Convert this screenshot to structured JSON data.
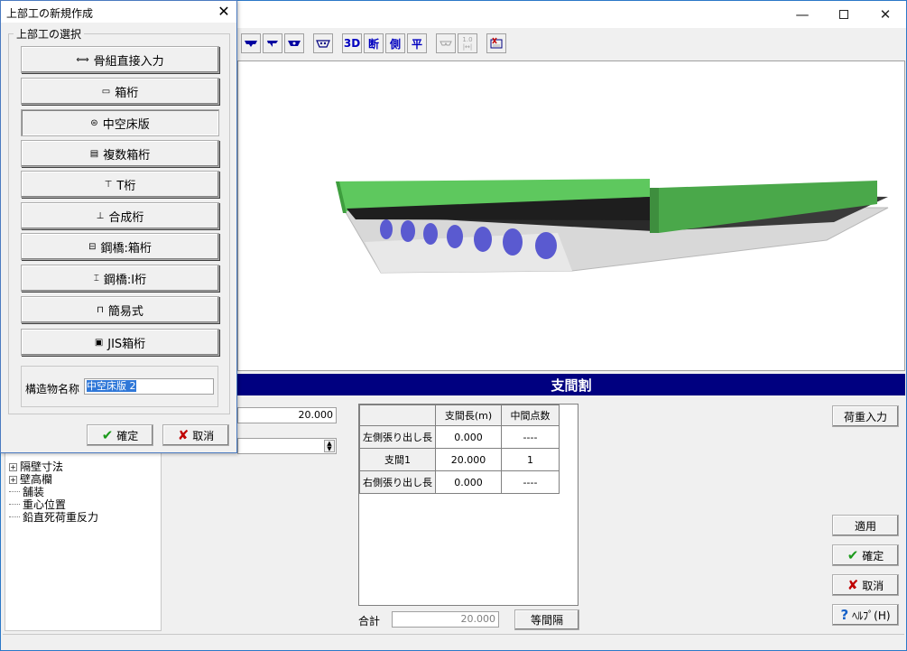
{
  "main_window": {
    "controls": {
      "minimize": "—",
      "close": "✕"
    }
  },
  "toolbar": {
    "buttons": [
      {
        "label": "",
        "icon": "view-front-icon"
      },
      {
        "label": "",
        "icon": "view-curve-icon"
      },
      {
        "label": "",
        "icon": "view-section-icon"
      },
      {
        "label": "",
        "icon": "box-view-icon"
      },
      {
        "label": "3D",
        "icon": "3d-view-icon"
      },
      {
        "label": "断",
        "icon": "section-view-icon"
      },
      {
        "label": "側",
        "icon": "side-view-icon"
      },
      {
        "label": "平",
        "icon": "plan-view-icon"
      },
      {
        "label": "",
        "icon": "bend-icon"
      },
      {
        "label": "1.0",
        "icon": "dimension-icon"
      },
      {
        "label": "",
        "icon": "export-icon"
      }
    ]
  },
  "span_section": {
    "header": "支間割",
    "top_value": "20.000",
    "grid": {
      "columns": [
        "支間長(m)",
        "中間点数"
      ],
      "rows": [
        {
          "label": "左側張り出し長",
          "length": "0.000",
          "points": "----"
        },
        {
          "label": "支間1",
          "length": "20.000",
          "points": "1"
        },
        {
          "label": "右側張り出し長",
          "length": "0.000",
          "points": "----"
        }
      ]
    },
    "total_label": "合計",
    "total_value": "20.000",
    "equal_button": "等間隔"
  },
  "tree": {
    "items": [
      {
        "label": "隔壁寸法",
        "expandable": true
      },
      {
        "label": "壁高欄",
        "expandable": true
      },
      {
        "label": "舗装",
        "expandable": false
      },
      {
        "label": "重心位置",
        "expandable": false
      },
      {
        "label": "鉛直死荷重反力",
        "expandable": false
      }
    ]
  },
  "right_buttons": {
    "load_input": "荷重入力",
    "apply": "適用",
    "ok": "確定",
    "cancel": "取消",
    "help": "ﾍﾙﾌﾟ(H)"
  },
  "dialog": {
    "title": "上部工の新規作成",
    "group_label": "上部工の選択",
    "options": [
      {
        "label": "骨組直接入力",
        "icon": "frame-icon"
      },
      {
        "label": "箱桁",
        "icon": "box-girder-icon"
      },
      {
        "label": "中空床版",
        "icon": "hollow-slab-icon",
        "selected": true
      },
      {
        "label": "複数箱桁",
        "icon": "multi-box-icon"
      },
      {
        "label": "T桁",
        "icon": "t-girder-icon"
      },
      {
        "label": "合成桁",
        "icon": "composite-girder-icon"
      },
      {
        "label": "鋼橋:箱桁",
        "icon": "steel-box-icon"
      },
      {
        "label": "鋼橋:I桁",
        "icon": "steel-i-icon"
      },
      {
        "label": "簡易式",
        "icon": "simple-icon"
      },
      {
        "label": "JIS箱桁",
        "icon": "jis-box-icon"
      }
    ],
    "name_label": "構造物名称",
    "name_value": "中空床版 2",
    "ok": "確定",
    "cancel": "取消"
  },
  "colors": {
    "header_bg": "#000080",
    "deck_green": "#5ec85e",
    "slab_gray": "#d8d8d8",
    "void_blue": "#5a5ad0"
  }
}
